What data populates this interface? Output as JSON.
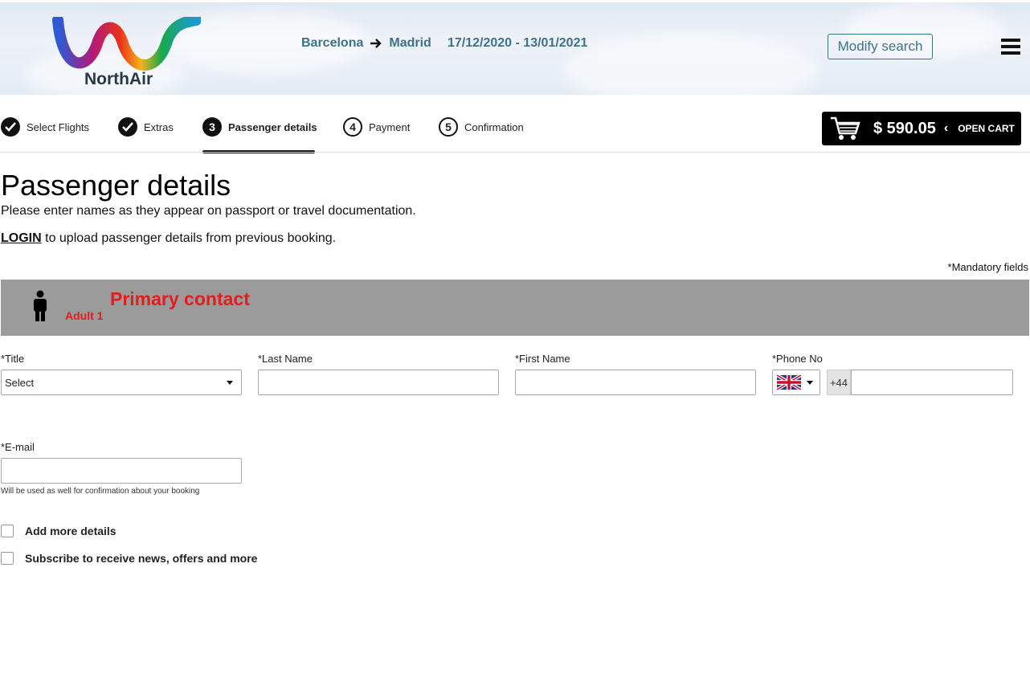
{
  "header": {
    "logo_text": "NorthAir",
    "origin": "Barcelona",
    "destination": "Madrid",
    "dates": "17/12/2020 - 13/01/2021",
    "modify_label": "Modify search"
  },
  "steps": [
    {
      "label": "Select Flights",
      "state": "done"
    },
    {
      "label": "Extras",
      "state": "done"
    },
    {
      "number": "3",
      "label": "Passenger details",
      "state": "active"
    },
    {
      "number": "4",
      "label": "Payment",
      "state": "todo"
    },
    {
      "number": "5",
      "label": "Confirmation",
      "state": "todo"
    }
  ],
  "cart": {
    "price": "$ 590.05",
    "chevron": "‹",
    "open_label": "OPEN CART"
  },
  "main": {
    "title": "Passenger details",
    "subtitle": "Please enter names as they appear on passport or travel documentation.",
    "login_link": "LOGIN",
    "login_text": " to upload passenger details from previous booking.",
    "mandatory_note": "*Mandatory fields"
  },
  "contact": {
    "adult_label": "Adult 1",
    "title": "Primary contact"
  },
  "form": {
    "title_label": "*Title",
    "title_value": "Select",
    "last_name_label": "*Last Name",
    "last_name_value": "",
    "first_name_label": "*First Name",
    "first_name_value": "",
    "phone_label": "*Phone No",
    "phone_prefix": "+44",
    "phone_value": "",
    "email_label": "*E-mail",
    "email_value": "",
    "email_helper": "Will be used as well for confirmation about your booking",
    "add_more_label": "Add more details",
    "subscribe_label": "Subscribe to receive news, offers and more"
  },
  "icons": {
    "check": "check-icon",
    "cart": "cart-icon",
    "menu": "hamburger-menu-icon",
    "person": "person-icon",
    "flag": "uk-flag-icon",
    "arrow": "arrow-right-icon"
  },
  "colors": {
    "accent_red": "#e21d1d",
    "header_text": "#3e7288",
    "cart_bg": "#000000",
    "contact_bar": "#9b9b9b"
  }
}
